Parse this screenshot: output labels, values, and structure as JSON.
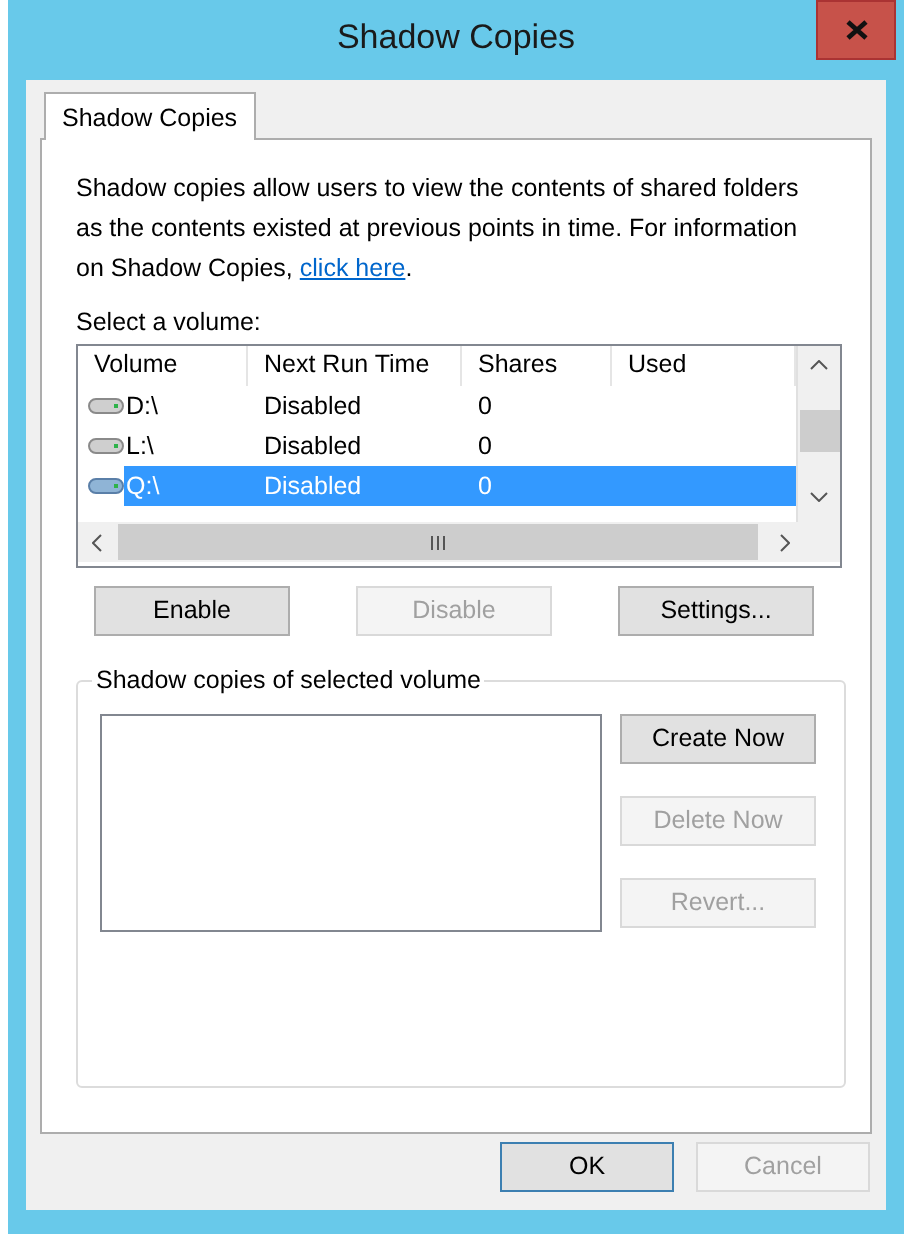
{
  "window": {
    "title": "Shadow Copies"
  },
  "tabs": [
    {
      "label": "Shadow Copies",
      "selected": true
    }
  ],
  "description": {
    "text": "Shadow copies allow users to view the contents of shared folders as the contents existed at previous points in time. For information on Shadow Copies,",
    "link": "click here",
    "text_after": "."
  },
  "volume_list": {
    "label": "Select a volume:",
    "columns": [
      "Volume",
      "Next Run Time",
      "Shares",
      "Used"
    ],
    "rows": [
      {
        "volume": "D:\\",
        "next_run_time": "Disabled",
        "shares": "0",
        "selected": false
      },
      {
        "volume": "L:\\",
        "next_run_time": "Disabled",
        "shares": "0",
        "selected": false
      },
      {
        "volume": "Q:\\",
        "next_run_time": "Disabled",
        "shares": "0",
        "selected": true
      }
    ]
  },
  "volume_buttons": [
    {
      "label": "Enable",
      "disabled": false
    },
    {
      "label": "Disable",
      "disabled": true
    },
    {
      "label": "Settings...",
      "disabled": false
    }
  ],
  "copies_group": {
    "title": "Shadow copies of selected volume",
    "buttons": [
      {
        "label": "Create Now",
        "disabled": false
      },
      {
        "label": "Delete Now",
        "disabled": true
      },
      {
        "label": "Revert...",
        "disabled": true
      }
    ]
  },
  "dialog_buttons": [
    {
      "label": "OK",
      "disabled": false,
      "default": true
    },
    {
      "label": "Cancel",
      "disabled": true,
      "default": false
    }
  ]
}
